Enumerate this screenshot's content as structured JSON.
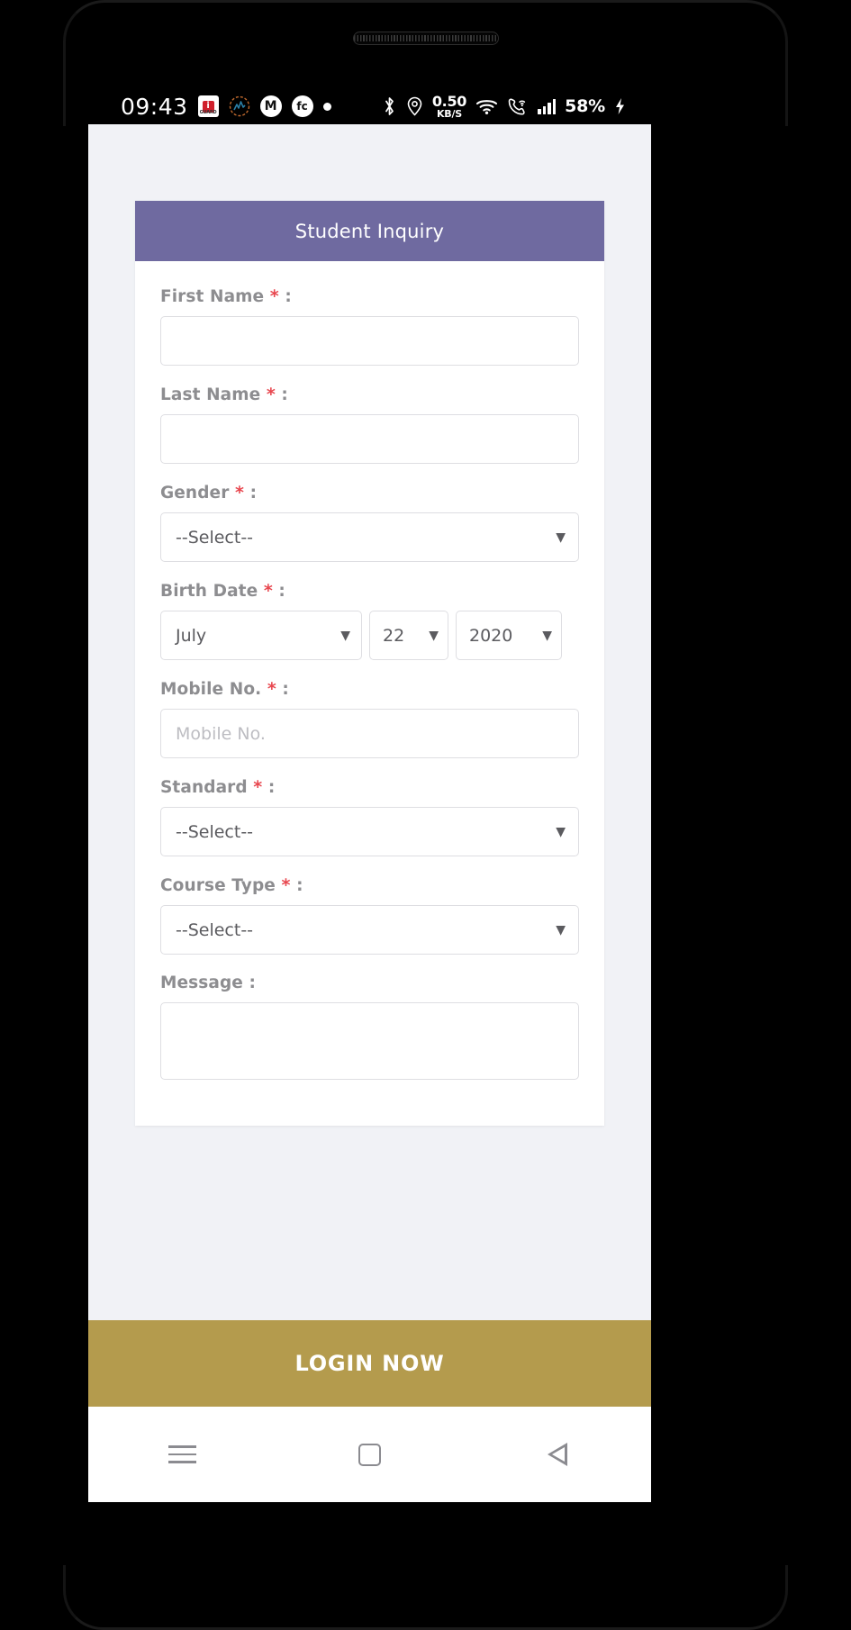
{
  "status_bar": {
    "clock": "09:43",
    "notification_icons": [
      {
        "name": "itv-guard-app-icon",
        "glyph": "i",
        "sub": "GUARD"
      },
      {
        "name": "activity-tracker-icon",
        "glyph": "⌁"
      },
      {
        "name": "medium-app-icon",
        "glyph": "M"
      },
      {
        "name": "fc-app-icon",
        "glyph": "fc"
      },
      {
        "name": "more-notifications-dot",
        "glyph": "•"
      }
    ],
    "bluetooth_icon": "bluetooth-icon",
    "location_icon": "location-pin-icon",
    "network_speed_value": "0.50",
    "network_speed_unit": "KB/S",
    "wifi_icon": "wifi-icon",
    "wifi_calling_icon": "wifi-calling-icon",
    "signal_icon": "cellular-signal-icon",
    "battery_percent": "58%",
    "charging_icon": "charging-bolt-icon"
  },
  "card": {
    "header_title": "Student Inquiry",
    "required_marker": "*",
    "colon": ":",
    "select_placeholder": "--Select--",
    "caret": "▼",
    "fields": [
      {
        "key": "first_name",
        "label": "First Name",
        "required": true,
        "type": "text",
        "value": "",
        "placeholder": ""
      },
      {
        "key": "last_name",
        "label": "Last Name",
        "required": true,
        "type": "text",
        "value": "",
        "placeholder": ""
      },
      {
        "key": "gender",
        "label": "Gender",
        "required": true,
        "type": "select",
        "value": "--Select--"
      },
      {
        "key": "birth_date",
        "label": "Birth Date",
        "required": true,
        "type": "date-group",
        "month": "July",
        "day": "22",
        "year": "2020"
      },
      {
        "key": "mobile_no",
        "label": "Mobile No.",
        "required": true,
        "type": "text",
        "value": "",
        "placeholder": "Mobile No."
      },
      {
        "key": "standard",
        "label": "Standard",
        "required": true,
        "type": "select",
        "value": "--Select--"
      },
      {
        "key": "course_type",
        "label": "Course Type",
        "required": true,
        "type": "select",
        "value": "--Select--"
      },
      {
        "key": "message",
        "label": "Message",
        "required": false,
        "type": "textarea",
        "value": "",
        "placeholder": ""
      }
    ]
  },
  "login_bar": {
    "label": "LOGIN NOW"
  },
  "nav_bar": {
    "recents_label": "recents-icon",
    "home_label": "home-icon",
    "back_label": "back-icon"
  },
  "colors": {
    "header_purple": "#6f6aa0",
    "login_gold": "#b49b4d",
    "page_bg": "#f1f2f6",
    "required_red": "#e8474f",
    "label_gray": "#8d8d90"
  }
}
